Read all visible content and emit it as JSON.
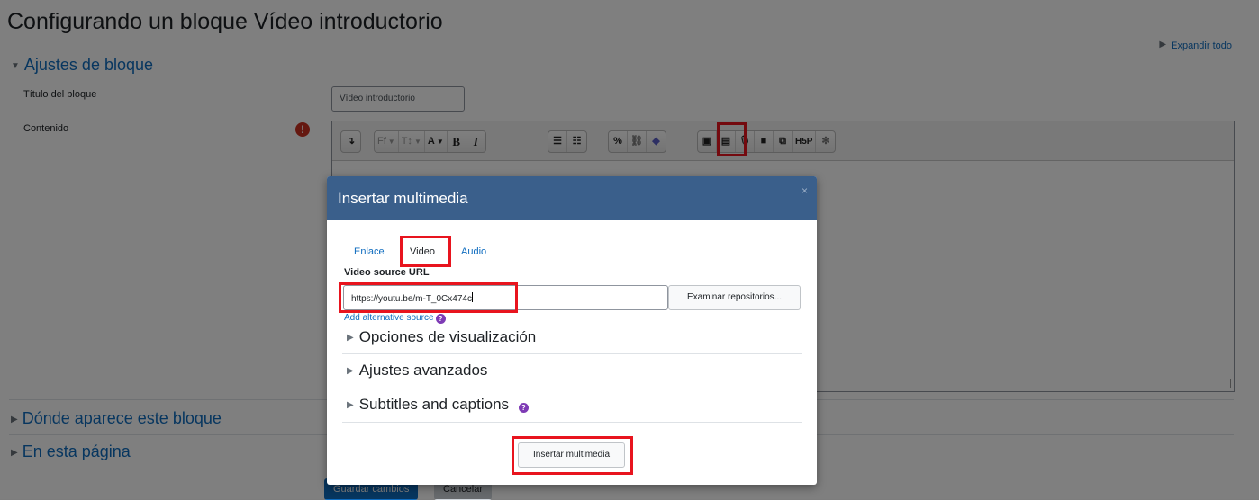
{
  "page": {
    "title": "Configurando un bloque Vídeo introductorio",
    "expand_all": "Expandir todo"
  },
  "form": {
    "section_block_settings": "Ajustes de bloque",
    "title_label": "Título del bloque",
    "title_value": "Vídeo introductorio",
    "content_label": "Contenido",
    "required_icon": "!",
    "section_where": "Dónde aparece este bloque",
    "section_this_page": "En esta página",
    "save_button": "Guardar cambios",
    "cancel_button": "Cancelar"
  },
  "toolbar": {
    "collapse": "↴",
    "font_family": "Ff",
    "font_size": "T↕",
    "font_color": "A",
    "bold": "B",
    "italic": "I",
    "bullet_list": "☰",
    "numbered_list": "☷",
    "link": "%",
    "unlink": "⛓",
    "teams": "◆",
    "image": "▣",
    "media": "▤",
    "record_audio": "🎙",
    "record_video": "■",
    "manage_files": "⧉",
    "h5p": "H5P",
    "accessibility": "✻",
    "dropdown": "▼"
  },
  "modal": {
    "title": "Insertar multimedia",
    "close": "×",
    "tabs": [
      "Enlace",
      "Video",
      "Audio"
    ],
    "active_tab": "Video",
    "url_label": "Video source URL",
    "url_value": "https://youtu.be/m-T_0Cx474c",
    "browse_button": "Examinar repositorios...",
    "alt_source": "Add alternative source",
    "help_icon": "?",
    "section_display": "Opciones de visualización",
    "section_advanced": "Ajustes avanzados",
    "section_subtitles": "Subtitles and captions",
    "insert_button": "Insertar multimedia"
  },
  "colors": {
    "header": "#3a5f8b",
    "link": "#0f6cbf",
    "highlight": "#e8141e",
    "primary_button": "#0f6cbf",
    "required": "#ca3120",
    "help": "#7e3bb5"
  }
}
